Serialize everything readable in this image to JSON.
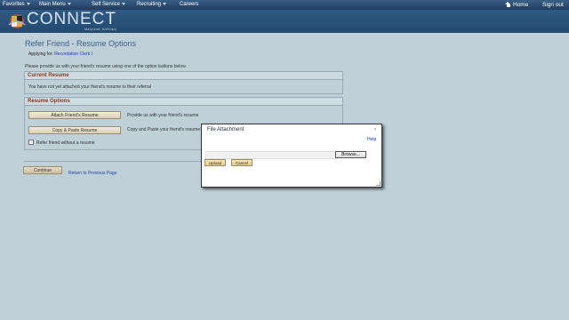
{
  "topnav": {
    "favorites": "Favorites",
    "main_menu": "Main Menu",
    "self_service": "Self Service",
    "recruiting": "Recruiting",
    "careers": "Careers",
    "home": "Home",
    "sign_out": "Sign out"
  },
  "brand": {
    "logo_text": "CONNECT",
    "logo_sub": "Maryland Judiciary"
  },
  "page": {
    "title": "Refer Friend - Resume Options",
    "applying_label": "Applying for:",
    "applying_value": "Recordation Clerk I",
    "intro": "Please provide us with your friend's resume using one of the option buttons below."
  },
  "current_resume": {
    "header": "Current Resume",
    "message": "You have not yet attached your friend's resume to their referral"
  },
  "resume_options": {
    "header": "Resume Options",
    "attach_button": "Attach Friend's Resume",
    "attach_desc": "Provide us with your friend's resume",
    "paste_button": "Copy & Paste Resume",
    "paste_desc": "Copy and Paste your friend's resume",
    "no_resume_label": "Refer friend without a resume"
  },
  "footer": {
    "continue": "Continue",
    "return": "Return to Previous Page"
  },
  "dialog": {
    "title": "File Attachment",
    "close": "×",
    "help": "Help",
    "browse": "Browse...",
    "upload": "Upload",
    "cancel": "Cancel"
  }
}
